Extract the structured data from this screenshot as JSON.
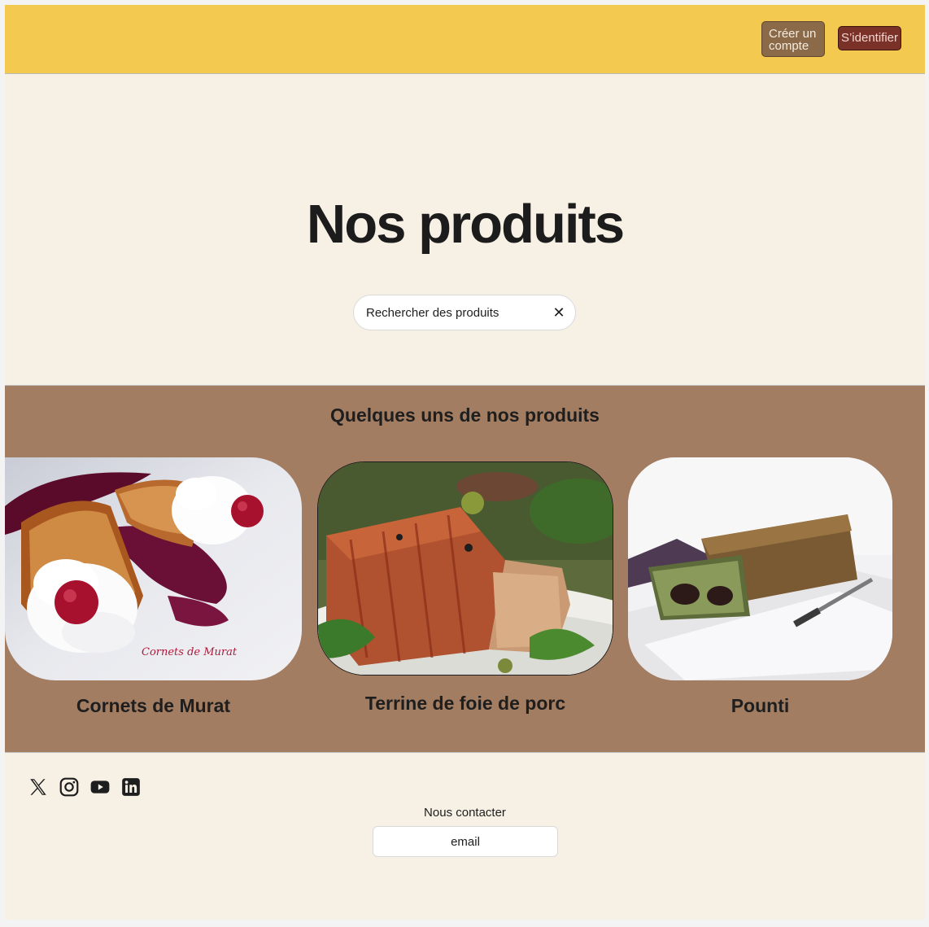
{
  "header": {
    "create_account_label": "Créer un compte",
    "login_label": "S’identifier",
    "background": "#f4c94f"
  },
  "hero": {
    "title": "Nos produits",
    "search": {
      "placeholder": "Rechercher des produits",
      "clear_icon": "close-icon"
    }
  },
  "products": {
    "title": "Quelques uns de nos produits",
    "background": "#a37d62",
    "items": [
      {
        "name": "Cornets de Murat",
        "image_caption": "Cornets de Murat"
      },
      {
        "name": "Terrine de foie de porc"
      },
      {
        "name": "Pounti"
      }
    ]
  },
  "footer": {
    "social_icons": [
      "x-icon",
      "instagram-icon",
      "youtube-icon",
      "linkedin-icon"
    ],
    "contact_label": "Nous contacter",
    "email_placeholder": "email"
  }
}
